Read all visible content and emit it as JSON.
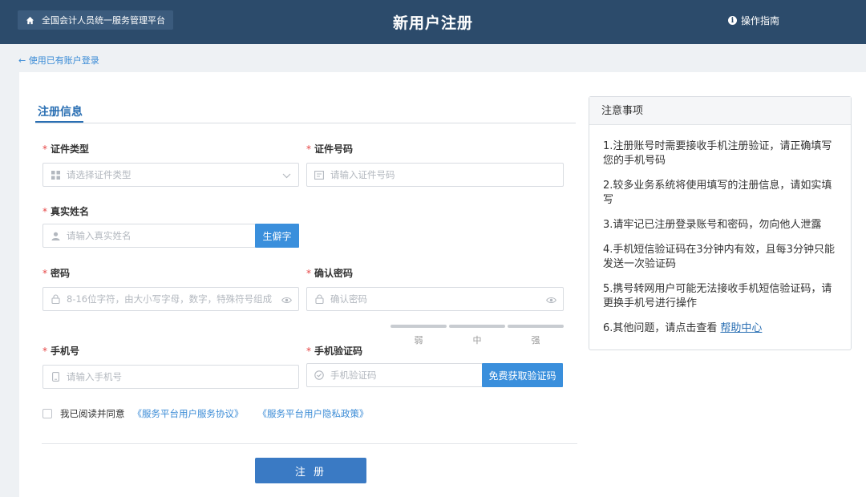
{
  "header": {
    "platform_name": "全国会计人员统一服务管理平台",
    "title": "新用户注册",
    "guide_label": "操作指南"
  },
  "back_link": "← 使用已有账户登录",
  "form": {
    "tab_label": "注册信息",
    "id_type": {
      "label": "证件类型",
      "placeholder": "请选择证件类型"
    },
    "id_number": {
      "label": "证件号码",
      "placeholder": "请输入证件号码"
    },
    "real_name": {
      "label": "真实姓名",
      "placeholder": "请输入真实姓名",
      "button": "生僻字"
    },
    "password": {
      "label": "密码",
      "placeholder": "8-16位字符，由大小写字母，数字，特殊符号组成"
    },
    "confirm_password": {
      "label": "确认密码",
      "placeholder": "确认密码"
    },
    "strength": {
      "weak": "弱",
      "medium": "中",
      "strong": "强"
    },
    "phone": {
      "label": "手机号",
      "placeholder": "请输入手机号"
    },
    "sms_code": {
      "label": "手机验证码",
      "placeholder": "手机验证码",
      "button": "免费获取验证码"
    },
    "agreement": {
      "text": "我已阅读并同意",
      "service_link": "《服务平台用户服务协议》",
      "privacy_link": "《服务平台用户隐私政策》"
    },
    "submit": "注 册"
  },
  "notice": {
    "title": "注意事项",
    "items": [
      "1.注册账号时需要接收手机注册验证，请正确填写您的手机号码",
      "2.较多业务系统将使用填写的注册信息，请如实填写",
      "3.请牢记已注册登录账号和密码，勿向他人泄露",
      "4.手机短信验证码在3分钟内有效，且每3分钟只能发送一次验证码",
      "5.携号转网用户可能无法接收手机短信验证码，请更换手机号进行操作",
      "6.其他问题，请点击查看"
    ],
    "help_link": "帮助中心"
  },
  "colors": {
    "header_bg": "#2c4b6b",
    "primary": "#3a8fdc",
    "required": "#e64545"
  }
}
